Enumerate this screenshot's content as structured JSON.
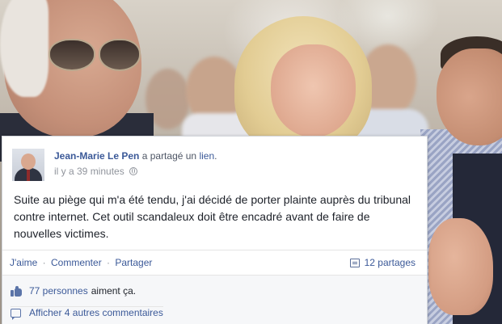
{
  "post": {
    "author": "Jean-Marie Le Pen",
    "action_text": " a partagé un ",
    "action_link": "lien",
    "action_end": ".",
    "timestamp": "il y a 39 minutes",
    "privacy_icon": "globe-icon",
    "body": "Suite au piège qui m'a été tendu, j'ai décidé de porter plainte auprès du tribunal contre internet. Cet outil scandaleux doit être encadré avant de faire de nouvelles victimes."
  },
  "actions": {
    "like": "J'aime",
    "separator": "·",
    "comment": "Commenter",
    "share": "Partager",
    "shares_icon": "share-icon",
    "shares_count": "12 partages"
  },
  "feedback": {
    "likes_icon": "thumbs-up-icon",
    "likes_link": "77 personnes",
    "likes_text": "aiment ça.",
    "comments_icon": "comment-icon",
    "comments_link": "Afficher 4 autres commentaires"
  },
  "colors": {
    "link": "#3b5998",
    "text": "#1d2129",
    "muted": "#90949c",
    "feedback_bg": "#f6f7f9"
  }
}
